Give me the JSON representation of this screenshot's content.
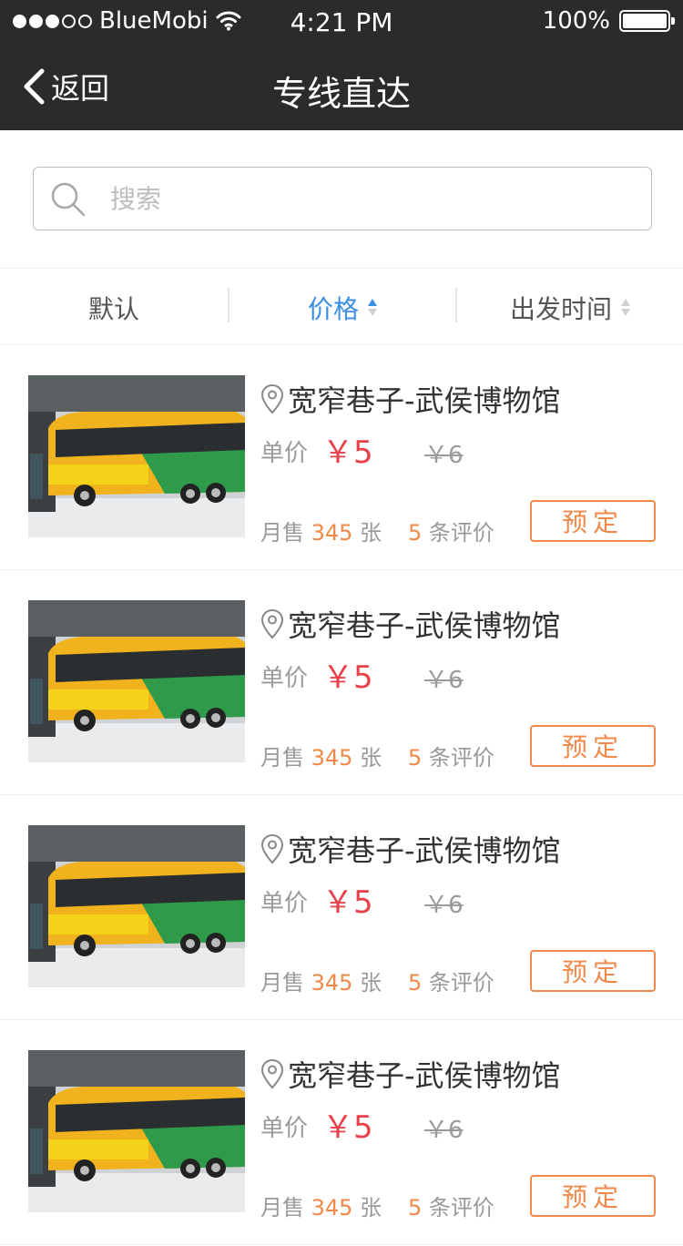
{
  "status_bar": {
    "carrier": "BlueMobi",
    "time": "4:21 PM",
    "battery": "100%"
  },
  "nav": {
    "back_label": "返回",
    "title": "专线直达"
  },
  "search": {
    "placeholder": "搜索",
    "value": ""
  },
  "filters": {
    "default_label": "默认",
    "price_label": "价格",
    "time_label": "出发时间",
    "active": "price"
  },
  "colors": {
    "accent_blue": "#3a8ee6",
    "price_red": "#e8414a",
    "orange": "#f0894a",
    "header_bg": "#2b2b2b"
  },
  "items": [
    {
      "route": "宽窄巷子-武侯博物馆",
      "price_label": "单价",
      "price": "￥5",
      "old_price": "￥6",
      "sold_label": "月售",
      "sold": "345",
      "sold_unit": "张",
      "reviews": "5",
      "reviews_label": "条评价",
      "book": "预定"
    },
    {
      "route": "宽窄巷子-武侯博物馆",
      "price_label": "单价",
      "price": "￥5",
      "old_price": "￥6",
      "sold_label": "月售",
      "sold": "345",
      "sold_unit": "张",
      "reviews": "5",
      "reviews_label": "条评价",
      "book": "预定"
    },
    {
      "route": "宽窄巷子-武侯博物馆",
      "price_label": "单价",
      "price": "￥5",
      "old_price": "￥6",
      "sold_label": "月售",
      "sold": "345",
      "sold_unit": "张",
      "reviews": "5",
      "reviews_label": "条评价",
      "book": "预定"
    },
    {
      "route": "宽窄巷子-武侯博物馆",
      "price_label": "单价",
      "price": "￥5",
      "old_price": "￥6",
      "sold_label": "月售",
      "sold": "345",
      "sold_unit": "张",
      "reviews": "5",
      "reviews_label": "条评价",
      "book": "预定"
    }
  ]
}
